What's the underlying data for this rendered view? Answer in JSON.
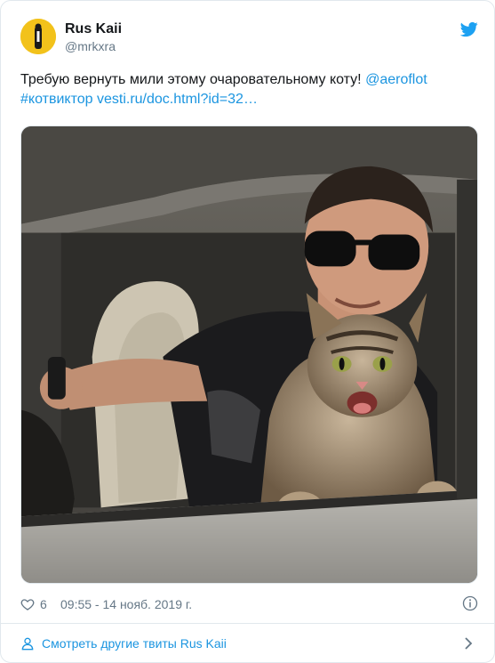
{
  "tweet": {
    "display_name": "Rus Kaii",
    "handle": "@mrkxra",
    "text_plain": "Требую вернуть мили этому очаровательному коту! ",
    "mention": "@aeroflot",
    "hashtag": "#котвиктор",
    "link": "vesti.ru/doc.html?id=32…",
    "like_count": "6",
    "timestamp": "09:55 - 14 нояб. 2019 г.",
    "footer_label": "Смотреть другие твиты Rus Kaii"
  },
  "icons": {
    "brand": "twitter-bird-icon",
    "like": "heart-icon",
    "info": "info-icon",
    "profile": "person-icon",
    "more": "chevron-right-icon"
  },
  "colors": {
    "link": "#1b95e0",
    "muted": "#657786",
    "border": "#e1e8ed",
    "avatar_bg": "#f2c21b"
  }
}
